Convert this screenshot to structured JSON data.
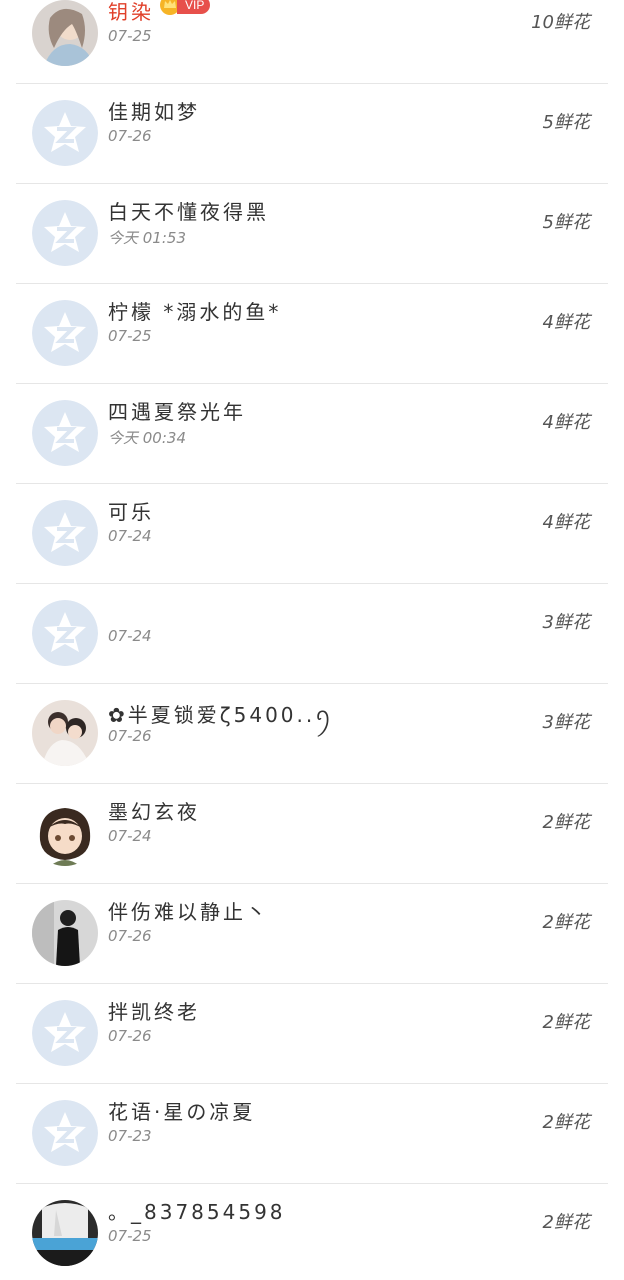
{
  "ranking": {
    "rows": [
      {
        "name": "钥染",
        "vip": "VIP",
        "date": "07-25",
        "count": "10鲜花",
        "avatar": "photo-girl"
      },
      {
        "name": "佳期如梦",
        "date": "07-26",
        "count": "5鲜花",
        "avatar": "default-qzone-star"
      },
      {
        "name": "白天不懂夜得黑",
        "date": "今天 01:53",
        "count": "5鲜花",
        "avatar": "default-qzone-star"
      },
      {
        "name": "柠檬 *溺水的鱼*",
        "date": "07-25",
        "count": "4鲜花",
        "avatar": "default-qzone-star"
      },
      {
        "name": "四遇夏祭光年",
        "date": "今天 00:34",
        "count": "4鲜花",
        "avatar": "default-qzone-star"
      },
      {
        "name": "可乐",
        "date": "07-24",
        "count": "4鲜花",
        "avatar": "default-qzone-star"
      },
      {
        "name": "",
        "date": "07-24",
        "count": "3鲜花",
        "avatar": "default-qzone-star"
      },
      {
        "name": "✿半夏锁爱ζ5400..ꪆ",
        "date": "07-26",
        "count": "3鲜花",
        "avatar": "photo-couple"
      },
      {
        "name": "墨幻玄夜",
        "date": "07-24",
        "count": "2鲜花",
        "avatar": "photo-anime-girl"
      },
      {
        "name": "伴伤难以静止丶",
        "date": "07-26",
        "count": "2鲜花",
        "avatar": "photo-dark-figure"
      },
      {
        "name": "拌凯终老",
        "date": "07-26",
        "count": "2鲜花",
        "avatar": "default-qzone-star"
      },
      {
        "name": "花语·星の凉夏",
        "date": "07-23",
        "count": "2鲜花",
        "avatar": "default-qzone-star"
      },
      {
        "name": "。_837854598",
        "date": "07-25",
        "count": "2鲜花",
        "avatar": "photo-face-hand"
      }
    ]
  },
  "colors": {
    "vip_name": "#e0402a",
    "vip_badge": "#e7504b",
    "divider": "#e6e6e6",
    "default_avatar": "#dce6f2"
  }
}
